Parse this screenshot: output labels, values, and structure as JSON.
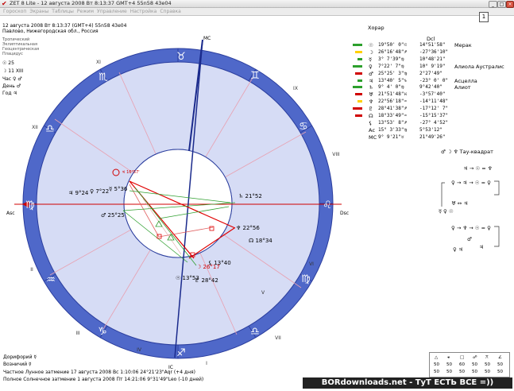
{
  "window": {
    "title": "ZET 8 Lite - 12 августа 2008  Вт   8:13:37 GMT+4 55n58  43e04",
    "page_number": "1"
  },
  "menu": [
    "Гороскоп",
    "Экраны",
    "Таблицы",
    "Режим",
    "Управление",
    "Настройка",
    "Справка"
  ],
  "chart_info": {
    "line1": "12 августа 2008  Вт   8:13:37 (GMT+4) 55n58  43e04",
    "line2": "Павлово, Нижегородская обл., Россия",
    "line3": "Тропический",
    "line4": "Эклиптикальная",
    "line5": "Геоцентрическая",
    "line6": "Плацидус",
    "sun_day": "☉ 25",
    "moon_day": "☽ 11 XIII",
    "hour": "Час ♀ ♂",
    "day": "День ♂",
    "year": "Год ♃"
  },
  "wheel": {
    "houses": [
      "I",
      "II",
      "III",
      "IV",
      "V",
      "VI",
      "VII",
      "VIII",
      "IX",
      "X",
      "XI",
      "XII"
    ],
    "angles": {
      "mc": "MC",
      "ic": "IC",
      "asc": "Asc",
      "dsc": "Dsc"
    },
    "planet_labels": {
      "mercury": "♃ 16°57'",
      "jupiter": "♃ 9°24",
      "venus": "♀ 7°22",
      "merc2": "☿ 5°36",
      "mars": "♂ 25°25",
      "saturn": "♄ 21°52",
      "neptune": "♆ 22°56",
      "node": "☊ 18°34",
      "moon": "☽ 26°17",
      "pluto": "♇ 28°42",
      "sun": "☉ 13°53",
      "lilith": "⚸ 13°40"
    }
  },
  "table": {
    "header": "Хорар",
    "col_dcl": "Dcl",
    "rows": [
      {
        "glyph": "☉",
        "pos": "19°50' 0\"♌",
        "dcl": "14°51'58\"",
        "star": "Мерак"
      },
      {
        "glyph": "☽",
        "pos": "26°16'48\"♐",
        "dcl": "-27°36'10\"",
        "star": ""
      },
      {
        "glyph": "☿",
        "pos": "3° 7'39\"♍",
        "dcl": "10°48'21\"",
        "star": ""
      },
      {
        "glyph": "♀",
        "pos": "7°22' 7\"♍",
        "dcl": "10° 9'19\"",
        "star": "Алиола Аустралис"
      },
      {
        "glyph": "♂",
        "pos": "25°25' 3\"♍",
        "dcl": "2°27'49\"",
        "star": ""
      },
      {
        "glyph": "♃",
        "pos": "13°40' 5\"♑",
        "dcl": "-23° 0' 0\"",
        "star": "Асцелла"
      },
      {
        "glyph": "♄",
        "pos": "9° 4' 0\"♍",
        "dcl": "9°42'40\"",
        "star": "Алиот"
      },
      {
        "glyph": "♅",
        "pos": "21°51'48\"♓",
        "dcl": "-3°57'40\"",
        "star": ""
      },
      {
        "glyph": "♆",
        "pos": "22°56'18\"♒",
        "dcl": "-14°11'48\"",
        "star": ""
      },
      {
        "glyph": "♇",
        "pos": "28°41'38\"♐",
        "dcl": "-17°12' 7\"",
        "star": ""
      },
      {
        "glyph": "☊",
        "pos": "18°33'49\"♒",
        "dcl": "-15°15'37\"",
        "star": ""
      },
      {
        "glyph": "⚸",
        "pos": "13°53' 8\"♐",
        "dcl": "-27° 4'52\"",
        "star": ""
      },
      {
        "glyph": "Ас",
        "pos": "15° 3'33\"♍",
        "dcl": "5°53'12\"",
        "star": ""
      },
      {
        "glyph": "МС",
        "pos": "9° 9'21\"♉",
        "dcl": "21°49'26\"",
        "star": ""
      }
    ]
  },
  "configs": {
    "tau_square": "♂ ☽ ♆  Тау-квадрат",
    "f1": "♃ → ☉ = ♆",
    "f2": "♀ → ♃ → ☉ = ♀",
    "f3": "♅ ↔ ♃",
    "f4": "♀ → ♆ → ☉ = ♀",
    "f5": "♂",
    "f6": "♃",
    "f7": "☿ ♀ ☉",
    "f8": "♀ ♃"
  },
  "bottom": {
    "doriphory": "Дорифорий  ☿",
    "vozniy": "Возничий  ☿",
    "lunar": "Частное Лунное затмение 17 августа 2008 Вс  1:10:06 24°21'23\"Aqr (+4 дня)",
    "solar": "Полное Солнечное затмение 1 августа 2008 Пт  14:21:06  9°31'49\"Leo (-10 дней)"
  },
  "aspect_legend": {
    "row1": [
      "△",
      "⚹",
      "□",
      "☍",
      "⚻",
      "∠"
    ],
    "row2": [
      "50",
      "50",
      "60",
      "50",
      "50",
      "50"
    ],
    "row3": [
      "50",
      "50",
      "50",
      "50",
      "50",
      "50"
    ]
  },
  "watermark": "BORdownloads.net - ТуТ ЕСТЬ ВСЕ =))",
  "colors": {
    "accent_blue": "#2b3e9e",
    "ring_light": "#c8d0f0",
    "ring_blue": "#4f68c9",
    "aspect_red": "#e00000",
    "aspect_green": "#30a030"
  }
}
